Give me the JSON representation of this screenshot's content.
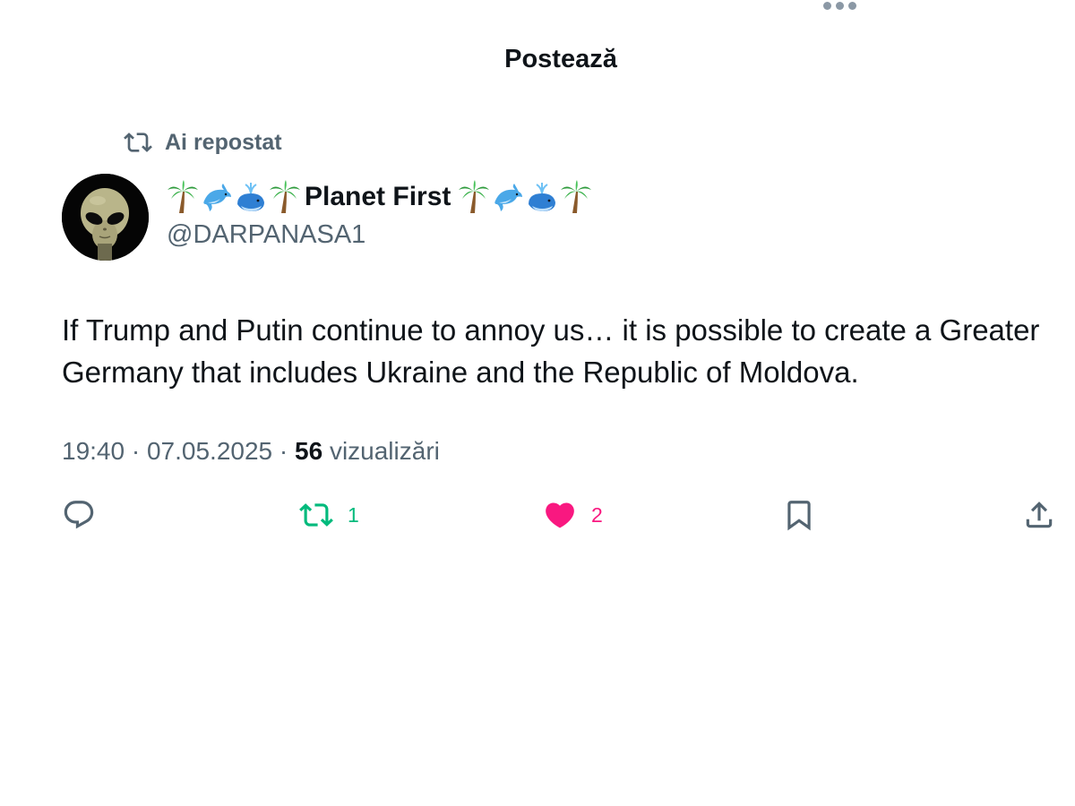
{
  "header": {
    "title": "Postează",
    "more_icon": "more-dots-icon"
  },
  "repost_context": {
    "label": "Ai repostat",
    "icon": "repost-icon"
  },
  "author": {
    "display_name": "Planet First",
    "name_emoji_before": [
      "palm-tree",
      "dolphin",
      "spouting-whale",
      "palm-tree"
    ],
    "name_emoji_after": [
      "palm-tree",
      "dolphin",
      "spouting-whale",
      "palm-tree"
    ],
    "handle": "@DARPANASA1",
    "avatar": "alien-face-avatar"
  },
  "tweet": {
    "text": "If Trump and Putin continue to annoy us… it is possible to create a Greater Germany that includes Ukraine and the Republic of Moldova."
  },
  "meta": {
    "time": "19:40",
    "separator": "·",
    "date": "07.05.2025",
    "views_count": "56",
    "views_label": "vizualizări"
  },
  "actions": {
    "reply": {
      "icon": "reply-icon",
      "count": ""
    },
    "retweet": {
      "icon": "retweet-icon",
      "count": "1",
      "active": true
    },
    "like": {
      "icon": "heart-icon",
      "count": "2",
      "active": true
    },
    "bookmark": {
      "icon": "bookmark-icon"
    },
    "share": {
      "icon": "share-icon"
    }
  },
  "colors": {
    "text_primary": "#0f1419",
    "text_secondary": "#536471",
    "retweet_green": "#00ba7c",
    "like_pink": "#f91880",
    "background": "#ffffff"
  }
}
